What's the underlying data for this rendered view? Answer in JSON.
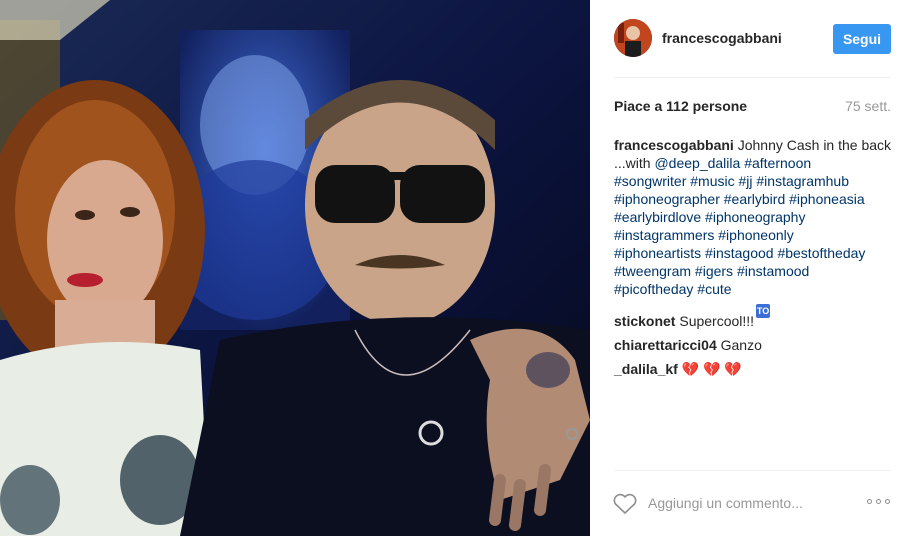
{
  "post": {
    "photo_icon": "post-photo",
    "author": "francescogabbani",
    "follow_label": "Segui",
    "likes_text": "Piace a 112 persone",
    "time_ago": "75 sett."
  },
  "caption": {
    "user": "francescogabbani",
    "lines": [
      "Johnny Cash in the back",
      "...with @deep_dalila #afternoon",
      "#songwriter #music #jj #instagramhub",
      "#iphoneographer #earlybird #iphoneasia",
      "#earlybirdlove #iphoneography",
      "#instagrammers #iphoneonly",
      "#iphoneartists #instagood #bestoftheday",
      "#tweengram #igers #instamood",
      "#picoftheday #cute"
    ]
  },
  "comments": [
    {
      "user": "stickonet",
      "text": "Supercool!!!",
      "emoji": "top-arrow-emoji",
      "badge": "TOP"
    },
    {
      "user": "chiarettaricci04",
      "text": "Ganzo"
    },
    {
      "user": "_dalila_kf",
      "text": "💔 💔 💔"
    }
  ],
  "footer": {
    "like_icon": "heart-outline-icon",
    "comment_placeholder": "Aggiungi un commento...",
    "more_icon": "more-options-icon"
  },
  "colors": {
    "accent": "#3897f0",
    "link": "#003569",
    "muted": "#999999"
  }
}
